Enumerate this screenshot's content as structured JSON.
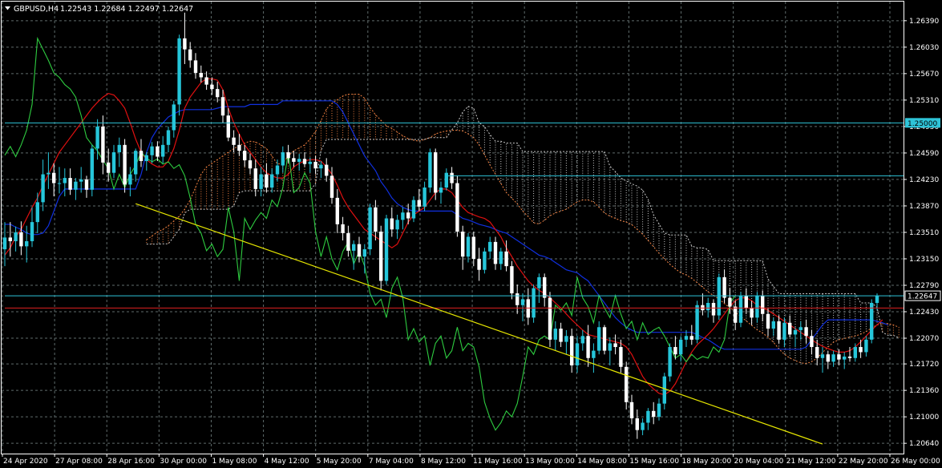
{
  "header": {
    "menu_icon": "triangle-down-icon",
    "symbol": "GBPUSD,H4",
    "ohlc": "1.22543 1.22684 1.22497 1.22647"
  },
  "colors": {
    "background": "#000000",
    "grid": "#5f6b6b",
    "bull": "#26c6da",
    "bear": "#ffffff",
    "tenkan": "#e01010",
    "kijun": "#1030e0",
    "chikou": "#2ecc40",
    "senkou_a": "#f08040",
    "senkou_b": "#c8c8c8",
    "trendline": "#e6e600",
    "hline_level": "#2ec4d8",
    "hline_price": "#2ec4d8",
    "hline_red": "#e02020"
  },
  "chart_data": {
    "type": "candlestick",
    "symbol": "GBPUSD",
    "timeframe": "H4",
    "ylim": [
      1.205,
      1.2665
    ],
    "y_ticks": [
      "1.26390",
      "1.26030",
      "1.25670",
      "1.25310",
      "1.24950",
      "1.24590",
      "1.24230",
      "1.23870",
      "1.23510",
      "1.23150",
      "1.22790",
      "1.22430",
      "1.22070",
      "1.21720",
      "1.21360",
      "1.21000",
      "1.20640"
    ],
    "x_tick_labels": [
      "24 Apr 2020",
      "27 Apr 08:00",
      "28 Apr 16:00",
      "30 Apr 00:00",
      "1 May 08:00",
      "4 May 12:00",
      "5 May 20:00",
      "7 May 04:00",
      "8 May 12:00",
      "11 May 16:00",
      "13 May 00:00",
      "14 May 08:00",
      "15 May 16:00",
      "18 May 20:00",
      "20 May 04:00",
      "21 May 12:00",
      "22 May 20:00",
      "26 May 00:00"
    ],
    "price_labels": [
      {
        "text": "1.25000",
        "value": 1.25,
        "kind": "level"
      },
      {
        "text": "1.22647",
        "value": 1.22647,
        "kind": "bid"
      }
    ],
    "hlines": [
      {
        "value": 1.25,
        "color": "#2ec4d8",
        "from_index": 0
      },
      {
        "value": 1.2428,
        "color": "#2ec4d8",
        "from_index": 81
      },
      {
        "value": 1.22647,
        "color": "#2ec4d8",
        "from_index": 0
      },
      {
        "value": 1.2248,
        "color": "#e02020",
        "from_index": 0
      }
    ],
    "trendline": {
      "from": {
        "index": 24,
        "price": 1.239
      },
      "to": {
        "index": 150,
        "price": 1.2063
      }
    },
    "candles": [
      [
        1.2328,
        1.2365,
        1.2305,
        1.2344
      ],
      [
        1.2344,
        1.2365,
        1.2318,
        1.2339
      ],
      [
        1.2339,
        1.2359,
        1.2325,
        1.2351
      ],
      [
        1.2351,
        1.2366,
        1.232,
        1.2332
      ],
      [
        1.2332,
        1.236,
        1.231,
        1.2339
      ],
      [
        1.2339,
        1.2385,
        1.2331,
        1.2365
      ],
      [
        1.2365,
        1.2405,
        1.235,
        1.2392
      ],
      [
        1.2392,
        1.245,
        1.238,
        1.243
      ],
      [
        1.243,
        1.246,
        1.241,
        1.2432
      ],
      [
        1.2432,
        1.2445,
        1.24,
        1.2418
      ],
      [
        1.2418,
        1.244,
        1.2404,
        1.2418
      ],
      [
        1.2418,
        1.2438,
        1.24,
        1.2425
      ],
      [
        1.2425,
        1.2438,
        1.2402,
        1.2409
      ],
      [
        1.2409,
        1.2425,
        1.2395,
        1.242
      ],
      [
        1.242,
        1.244,
        1.2405,
        1.2423
      ],
      [
        1.2423,
        1.2428,
        1.2398,
        1.2409
      ],
      [
        1.2409,
        1.247,
        1.24,
        1.2465
      ],
      [
        1.2465,
        1.2505,
        1.245,
        1.2495
      ],
      [
        1.2495,
        1.251,
        1.243,
        1.2446
      ],
      [
        1.2446,
        1.2465,
        1.242,
        1.2432
      ],
      [
        1.2432,
        1.247,
        1.2425,
        1.246
      ],
      [
        1.246,
        1.248,
        1.244,
        1.247
      ],
      [
        1.247,
        1.2478,
        1.2405,
        1.2416
      ],
      [
        1.2416,
        1.244,
        1.24,
        1.243
      ],
      [
        1.243,
        1.2465,
        1.242,
        1.2462
      ],
      [
        1.2462,
        1.2478,
        1.244,
        1.2448
      ],
      [
        1.2448,
        1.246,
        1.2435,
        1.2456
      ],
      [
        1.2456,
        1.2474,
        1.2445,
        1.2468
      ],
      [
        1.2468,
        1.2475,
        1.2448,
        1.2454
      ],
      [
        1.2454,
        1.2482,
        1.2445,
        1.247
      ],
      [
        1.247,
        1.2495,
        1.246,
        1.249
      ],
      [
        1.249,
        1.253,
        1.248,
        1.2525
      ],
      [
        1.2525,
        1.262,
        1.251,
        1.2615
      ],
      [
        1.2615,
        1.265,
        1.258,
        1.26
      ],
      [
        1.26,
        1.261,
        1.2575,
        1.2585
      ],
      [
        1.2585,
        1.2595,
        1.256,
        1.2568
      ],
      [
        1.2568,
        1.2578,
        1.2555,
        1.2562
      ],
      [
        1.2562,
        1.257,
        1.2545,
        1.2552
      ],
      [
        1.2552,
        1.2562,
        1.2538,
        1.2546
      ],
      [
        1.2546,
        1.2556,
        1.2528,
        1.2535
      ],
      [
        1.2535,
        1.2545,
        1.25,
        1.251
      ],
      [
        1.251,
        1.252,
        1.2475,
        1.248
      ],
      [
        1.248,
        1.249,
        1.246,
        1.247
      ],
      [
        1.247,
        1.2485,
        1.2455,
        1.2462
      ],
      [
        1.2462,
        1.247,
        1.244,
        1.2449
      ],
      [
        1.2449,
        1.2458,
        1.243,
        1.2438
      ],
      [
        1.2438,
        1.245,
        1.24,
        1.241
      ],
      [
        1.241,
        1.244,
        1.24,
        1.243
      ],
      [
        1.243,
        1.2445,
        1.2405,
        1.2412
      ],
      [
        1.2412,
        1.2438,
        1.2405,
        1.243
      ],
      [
        1.243,
        1.245,
        1.242,
        1.2442
      ],
      [
        1.2442,
        1.2468,
        1.2432,
        1.246
      ],
      [
        1.246,
        1.247,
        1.2445,
        1.2452
      ],
      [
        1.2452,
        1.2462,
        1.244,
        1.2447
      ],
      [
        1.2447,
        1.2458,
        1.2435,
        1.2451
      ],
      [
        1.2451,
        1.246,
        1.244,
        1.2444
      ],
      [
        1.2444,
        1.2453,
        1.2432,
        1.2447
      ],
      [
        1.2447,
        1.2455,
        1.243,
        1.2438
      ],
      [
        1.2438,
        1.2448,
        1.2425,
        1.2443
      ],
      [
        1.2443,
        1.2452,
        1.242,
        1.2428
      ],
      [
        1.2428,
        1.244,
        1.239,
        1.2398
      ],
      [
        1.2398,
        1.241,
        1.235,
        1.2362
      ],
      [
        1.2362,
        1.2372,
        1.234,
        1.235
      ],
      [
        1.235,
        1.236,
        1.2318,
        1.2326
      ],
      [
        1.2326,
        1.234,
        1.23,
        1.2335
      ],
      [
        1.2335,
        1.2345,
        1.231,
        1.2318
      ],
      [
        1.2318,
        1.2335,
        1.2295,
        1.2328
      ],
      [
        1.2328,
        1.239,
        1.232,
        1.2385
      ],
      [
        1.2385,
        1.2395,
        1.234,
        1.2352
      ],
      [
        1.2352,
        1.236,
        1.2272,
        1.2285
      ],
      [
        1.2285,
        1.2375,
        1.228,
        1.237
      ],
      [
        1.237,
        1.2385,
        1.2345,
        1.2355
      ],
      [
        1.2355,
        1.2375,
        1.2342,
        1.2368
      ],
      [
        1.2368,
        1.2385,
        1.2355,
        1.2378
      ],
      [
        1.2378,
        1.239,
        1.2362,
        1.237
      ],
      [
        1.237,
        1.24,
        1.2365,
        1.2395
      ],
      [
        1.2395,
        1.241,
        1.238,
        1.2386
      ],
      [
        1.2386,
        1.242,
        1.238,
        1.2412
      ],
      [
        1.2412,
        1.2465,
        1.2405,
        1.246
      ],
      [
        1.246,
        1.2465,
        1.2395,
        1.2405
      ],
      [
        1.2405,
        1.242,
        1.239,
        1.2412
      ],
      [
        1.2412,
        1.2438,
        1.2408,
        1.2432
      ],
      [
        1.2432,
        1.244,
        1.241,
        1.2418
      ],
      [
        1.2418,
        1.2428,
        1.2345,
        1.2352
      ],
      [
        1.2352,
        1.236,
        1.23,
        1.2318
      ],
      [
        1.2318,
        1.235,
        1.231,
        1.2345
      ],
      [
        1.2345,
        1.2352,
        1.2305,
        1.2315
      ],
      [
        1.2315,
        1.233,
        1.2285,
        1.23
      ],
      [
        1.23,
        1.233,
        1.2295,
        1.2325
      ],
      [
        1.2325,
        1.2345,
        1.2315,
        1.2338
      ],
      [
        1.2338,
        1.2345,
        1.23,
        1.2308
      ],
      [
        1.2308,
        1.233,
        1.23,
        1.2325
      ],
      [
        1.2325,
        1.234,
        1.2298,
        1.2305
      ],
      [
        1.2305,
        1.2312,
        1.226,
        1.2268
      ],
      [
        1.2268,
        1.228,
        1.224,
        1.2252
      ],
      [
        1.2252,
        1.2268,
        1.223,
        1.226
      ],
      [
        1.226,
        1.2275,
        1.2225,
        1.2235
      ],
      [
        1.2235,
        1.228,
        1.2228,
        1.2275
      ],
      [
        1.2275,
        1.2295,
        1.2255,
        1.229
      ],
      [
        1.229,
        1.2295,
        1.225,
        1.2262
      ],
      [
        1.2262,
        1.227,
        1.2195,
        1.2205
      ],
      [
        1.2205,
        1.223,
        1.219,
        1.222
      ],
      [
        1.222,
        1.2228,
        1.2195,
        1.2202
      ],
      [
        1.2202,
        1.2218,
        1.2185,
        1.221
      ],
      [
        1.221,
        1.222,
        1.216,
        1.217
      ],
      [
        1.217,
        1.221,
        1.216,
        1.22
      ],
      [
        1.22,
        1.2218,
        1.219,
        1.221
      ],
      [
        1.221,
        1.2225,
        1.2168,
        1.218
      ],
      [
        1.218,
        1.22,
        1.216,
        1.219
      ],
      [
        1.219,
        1.223,
        1.2185,
        1.2222
      ],
      [
        1.2222,
        1.2225,
        1.2185,
        1.219
      ],
      [
        1.219,
        1.2208,
        1.217,
        1.22
      ],
      [
        1.22,
        1.2212,
        1.2185,
        1.2195
      ],
      [
        1.2195,
        1.2205,
        1.216,
        1.2168
      ],
      [
        1.2168,
        1.2175,
        1.211,
        1.212
      ],
      [
        1.212,
        1.213,
        1.209,
        1.2098
      ],
      [
        1.2098,
        1.211,
        1.207,
        1.2082
      ],
      [
        1.2082,
        1.2098,
        1.2075,
        1.2092
      ],
      [
        1.2092,
        1.2112,
        1.2082,
        1.2108
      ],
      [
        1.2108,
        1.212,
        1.209,
        1.21
      ],
      [
        1.21,
        1.2125,
        1.2095,
        1.2118
      ],
      [
        1.2118,
        1.216,
        1.211,
        1.2155
      ],
      [
        1.2155,
        1.22,
        1.2148,
        1.2195
      ],
      [
        1.2195,
        1.221,
        1.2178,
        1.2185
      ],
      [
        1.2185,
        1.221,
        1.2175,
        1.2205
      ],
      [
        1.2205,
        1.2218,
        1.2195,
        1.221
      ],
      [
        1.221,
        1.2225,
        1.2198,
        1.2205
      ],
      [
        1.2205,
        1.2258,
        1.22,
        1.2252
      ],
      [
        1.2252,
        1.2268,
        1.2238,
        1.2245
      ],
      [
        1.2245,
        1.2262,
        1.2235,
        1.2255
      ],
      [
        1.2255,
        1.226,
        1.2228,
        1.2238
      ],
      [
        1.2238,
        1.2295,
        1.2232,
        1.229
      ],
      [
        1.229,
        1.23,
        1.2255,
        1.2262
      ],
      [
        1.2262,
        1.2275,
        1.224,
        1.225
      ],
      [
        1.225,
        1.2258,
        1.2218,
        1.2228
      ],
      [
        1.2228,
        1.227,
        1.2222,
        1.2265
      ],
      [
        1.2265,
        1.2275,
        1.224,
        1.2248
      ],
      [
        1.2248,
        1.2258,
        1.2225,
        1.2235
      ],
      [
        1.2235,
        1.227,
        1.2228,
        1.2265
      ],
      [
        1.2265,
        1.2272,
        1.223,
        1.224
      ],
      [
        1.224,
        1.2248,
        1.221,
        1.222
      ],
      [
        1.222,
        1.2235,
        1.221,
        1.223
      ],
      [
        1.223,
        1.2238,
        1.22,
        1.2205
      ],
      [
        1.2205,
        1.2235,
        1.2195,
        1.2228
      ],
      [
        1.2228,
        1.2238,
        1.2208,
        1.2212
      ],
      [
        1.2212,
        1.2222,
        1.2195,
        1.2218
      ],
      [
        1.2218,
        1.223,
        1.2205,
        1.2222
      ],
      [
        1.2222,
        1.2232,
        1.22,
        1.221
      ],
      [
        1.221,
        1.2218,
        1.2185,
        1.2195
      ],
      [
        1.2195,
        1.2205,
        1.217,
        1.218
      ],
      [
        1.218,
        1.2195,
        1.216,
        1.2185
      ],
      [
        1.2185,
        1.219,
        1.2165,
        1.2175
      ],
      [
        1.2175,
        1.219,
        1.2168,
        1.2185
      ],
      [
        1.2185,
        1.2192,
        1.217,
        1.2178
      ],
      [
        1.2178,
        1.2188,
        1.2165,
        1.2182
      ],
      [
        1.2182,
        1.2195,
        1.2175,
        1.218
      ],
      [
        1.218,
        1.22,
        1.2175,
        1.2195
      ],
      [
        1.2195,
        1.2205,
        1.218,
        1.2188
      ],
      [
        1.2188,
        1.221,
        1.2182,
        1.2205
      ],
      [
        1.2205,
        1.226,
        1.22,
        1.2255
      ],
      [
        1.2255,
        1.2268,
        1.2245,
        1.2265
      ]
    ],
    "tenkan_sen": [
      1.232,
      1.233,
      1.2345,
      1.2355,
      1.237,
      1.2385,
      1.2398,
      1.2415,
      1.243,
      1.2445,
      1.246,
      1.247,
      1.248,
      1.249,
      1.25,
      1.251,
      1.252,
      1.2528,
      1.2535,
      1.254,
      1.2538,
      1.253,
      1.252,
      1.25,
      1.2478,
      1.246,
      1.245,
      1.2444,
      1.244,
      1.244,
      1.2448,
      1.2465,
      1.249,
      1.252,
      1.2535,
      1.2545,
      1.2555,
      1.256,
      1.256,
      1.2558,
      1.2545,
      1.252,
      1.25,
      1.2485,
      1.247,
      1.246,
      1.245,
      1.244,
      1.2432,
      1.2428,
      1.2425,
      1.2425,
      1.243,
      1.244,
      1.2445,
      1.2448,
      1.245,
      1.245,
      1.2448,
      1.244,
      1.243,
      1.2415,
      1.2398,
      1.2385,
      1.2375,
      1.2365,
      1.2355,
      1.235,
      1.2345,
      1.234,
      1.2335,
      1.233,
      1.2335,
      1.235,
      1.2365,
      1.2375,
      1.238,
      1.2385,
      1.2395,
      1.2405,
      1.241,
      1.241,
      1.2405,
      1.2395,
      1.2385,
      1.2378,
      1.2375,
      1.2372,
      1.237,
      1.2365,
      1.2355,
      1.2345,
      1.233,
      1.2318,
      1.2305,
      1.2295,
      1.2285,
      1.2278,
      1.2272,
      1.2268,
      1.2262,
      1.2255,
      1.2248,
      1.224,
      1.2232,
      1.2225,
      1.2218,
      1.2212,
      1.221,
      1.2208,
      1.2206,
      1.2204,
      1.2202,
      1.22,
      1.2195,
      1.2185,
      1.217,
      1.2155,
      1.2145,
      1.2138,
      1.2132,
      1.213,
      1.2135,
      1.2145,
      1.216,
      1.2175,
      1.2188,
      1.2198,
      1.2205,
      1.2212,
      1.222,
      1.223,
      1.224,
      1.225,
      1.2258,
      1.2262,
      1.2262,
      1.2258,
      1.2252,
      1.2248,
      1.2245,
      1.224,
      1.2235,
      1.223,
      1.2225,
      1.222,
      1.2215,
      1.221,
      1.2205,
      1.22,
      1.2196,
      1.2193,
      1.219,
      1.2188,
      1.2188,
      1.219,
      1.2195,
      1.2202,
      1.221,
      1.2218,
      1.2225,
      1.2232
    ],
    "kijun_sen": [
      1.2362,
      1.2362,
      1.2358,
      1.2355,
      1.235,
      1.2348,
      1.2348,
      1.235,
      1.236,
      1.238,
      1.24,
      1.241,
      1.241,
      1.241,
      1.241,
      1.241,
      1.241,
      1.241,
      1.241,
      1.241,
      1.241,
      1.241,
      1.241,
      1.241,
      1.241,
      1.243,
      1.246,
      1.248,
      1.2492,
      1.25,
      1.2508,
      1.2512,
      1.2516,
      1.2518,
      1.2518,
      1.2518,
      1.2518,
      1.2518,
      1.2518,
      1.252,
      1.2522,
      1.2522,
      1.2522,
      1.2522,
      1.2522,
      1.2525,
      1.2525,
      1.2525,
      1.2525,
      1.2525,
      1.2525,
      1.253,
      1.253,
      1.253,
      1.253,
      1.253,
      1.253,
      1.253,
      1.253,
      1.253,
      1.253,
      1.2525,
      1.2515,
      1.25,
      1.2485,
      1.247,
      1.2455,
      1.2445,
      1.2435,
      1.242,
      1.241,
      1.2398,
      1.239,
      1.2385,
      1.2382,
      1.238,
      1.238,
      1.238,
      1.238,
      1.238,
      1.238,
      1.238,
      1.238,
      1.2375,
      1.237,
      1.2368,
      1.2365,
      1.2362,
      1.236,
      1.2358,
      1.2355,
      1.2352,
      1.235,
      1.2345,
      1.234,
      1.2335,
      1.233,
      1.2325,
      1.232,
      1.2318,
      1.2315,
      1.231,
      1.2305,
      1.23,
      1.2298,
      1.2296,
      1.229,
      1.2285,
      1.2275,
      1.2265,
      1.2255,
      1.2245,
      1.2235,
      1.2228,
      1.2222,
      1.2218,
      1.2215,
      1.2215,
      1.2215,
      1.2215,
      1.2215,
      1.2215,
      1.2215,
      1.2215,
      1.2215,
      1.2215,
      1.2215,
      1.2212,
      1.2208,
      1.2205,
      1.22,
      1.2195,
      1.2192,
      1.2192,
      1.2192,
      1.2192,
      1.2192,
      1.2192,
      1.2192,
      1.2192,
      1.2192,
      1.2192,
      1.2192,
      1.2192,
      1.2192,
      1.2192,
      1.2192,
      1.2195,
      1.2205,
      1.2215,
      1.2225,
      1.2232,
      1.2232,
      1.2232,
      1.2232,
      1.2232,
      1.2232,
      1.2232,
      1.2232,
      1.2232,
      1.223,
      1.2228,
      1.2225
    ]
  }
}
